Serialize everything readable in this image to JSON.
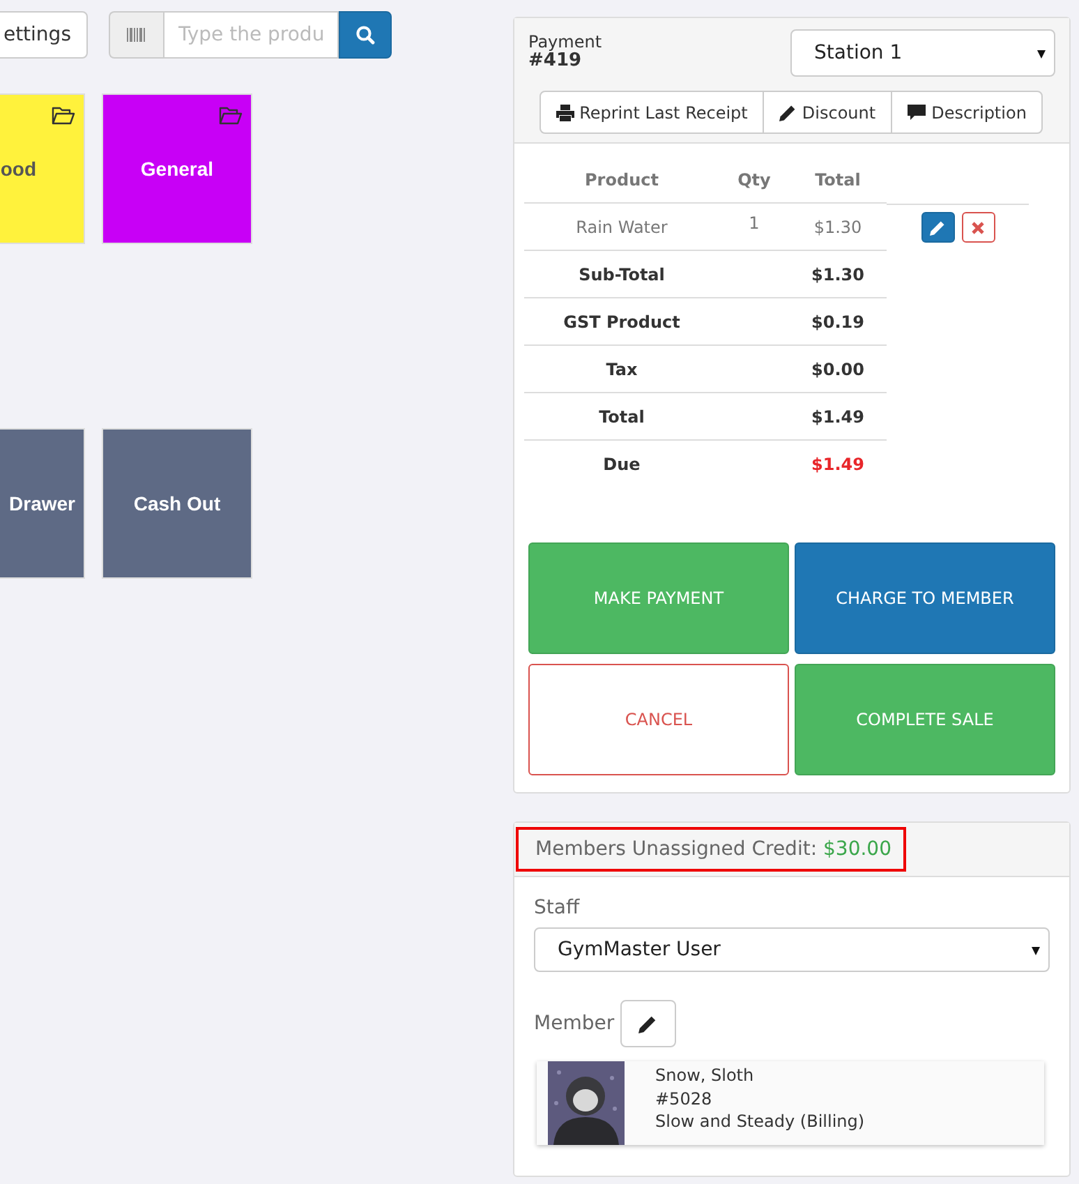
{
  "toolbar": {
    "settings_button": "ettings",
    "search": {
      "placeholder": "Type the produ"
    }
  },
  "tiles": [
    [
      {
        "label": "ood",
        "color": "#fff23c",
        "kind": "folder"
      },
      {
        "label": "General",
        "color": "#c800f6",
        "kind": "folder"
      }
    ],
    [
      {
        "label": "Drawer",
        "color": "#5e6a85",
        "kind": "action"
      },
      {
        "label": "Cash Out",
        "color": "#5e6a85",
        "kind": "action"
      }
    ]
  ],
  "payment": {
    "label": "Payment",
    "number": "#419",
    "station": "Station 1",
    "actions": [
      "Reprint Last Receipt",
      "Discount",
      "Description"
    ],
    "columns": [
      "Product",
      "Qty",
      "Total"
    ],
    "rows": [
      {
        "kind": "item",
        "product": "Rain Water",
        "qty": "1",
        "total": "$1.30"
      },
      {
        "kind": "summary",
        "product": "Sub-Total",
        "total": "$1.30"
      },
      {
        "kind": "summary",
        "product": "GST Product",
        "total": "$0.19"
      },
      {
        "kind": "summary",
        "product": "Tax",
        "total": "$0.00"
      },
      {
        "kind": "summary",
        "product": "Total",
        "total": "$1.49"
      },
      {
        "kind": "due",
        "product": "Due",
        "total": "$1.49"
      }
    ],
    "buttons": [
      {
        "label": "MAKE PAYMENT",
        "kind": "success"
      },
      {
        "label": "CHARGE TO MEMBER",
        "kind": "primary"
      },
      {
        "label": "CANCEL",
        "kind": "cancel"
      },
      {
        "label": "COMPLETE SALE",
        "kind": "success"
      }
    ]
  },
  "member_panel": {
    "credit_label": "Members Unassigned Credit:",
    "credit_amount": "$30.00",
    "staff_label": "Staff",
    "staff": "GymMaster User",
    "member_label": "Member",
    "member": {
      "name": "Snow, Sloth",
      "number": "#5028",
      "membership": "Slow and Steady (Billing)"
    }
  }
}
